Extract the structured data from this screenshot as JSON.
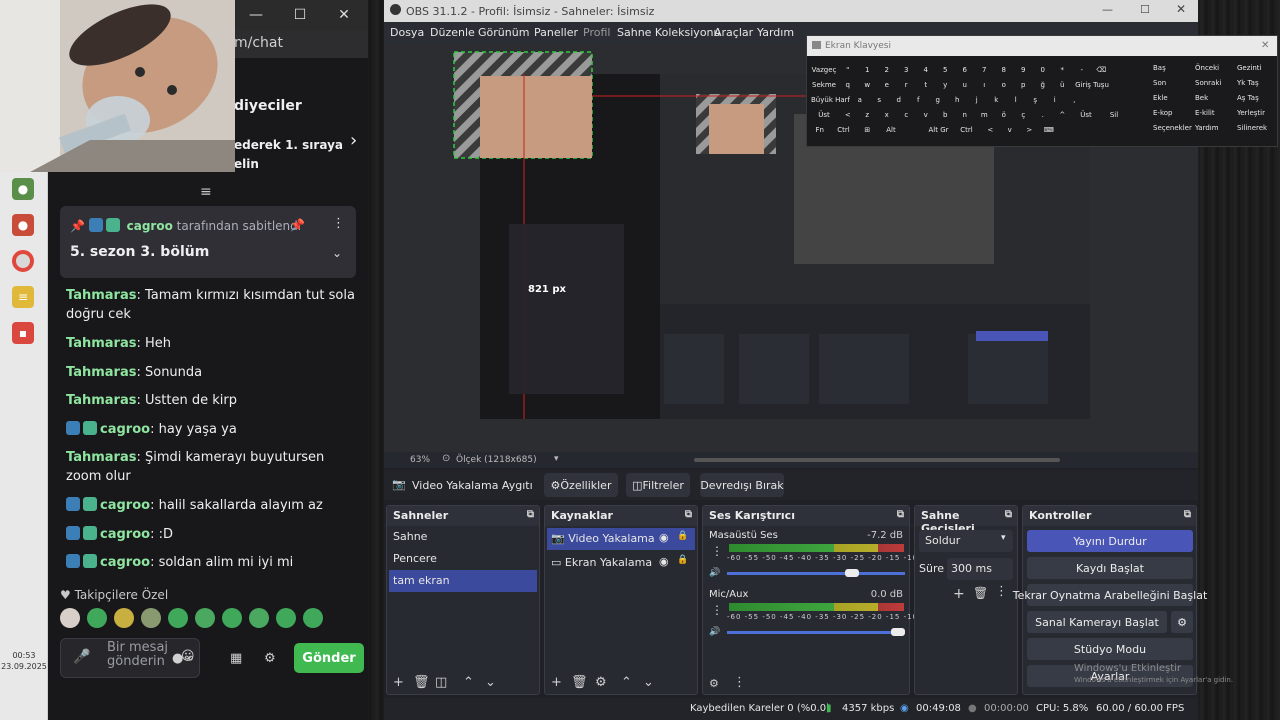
{
  "chat": {
    "url_fragment": "m/chat",
    "header_line1": "diyeciler",
    "header_line2": "ederek 1. sıraya elin",
    "pinned_by_user": "cagroo",
    "pinned_by_suffix": "tarafından sabitlendi",
    "pinned_message": "5. sezon 3. bölüm",
    "messages": [
      {
        "user": "Tahmaras",
        "text": "Tamam kırmızı kısımdan tut sola doğru cek",
        "badges": false
      },
      {
        "user": "Tahmaras",
        "text": "Heh",
        "badges": false
      },
      {
        "user": "Tahmaras",
        "text": "Sonunda",
        "badges": false
      },
      {
        "user": "Tahmaras",
        "text": "Ustten de kirp",
        "badges": false
      },
      {
        "user": "cagroo",
        "text": "hay yaşa ya",
        "badges": true
      },
      {
        "user": "Tahmaras",
        "text": "Şimdi kamerayı buyutursen zoom olur",
        "badges": false
      },
      {
        "user": "cagroo",
        "text": "halil sakallarda alayım az",
        "badges": true
      },
      {
        "user": "cagroo",
        "text": ":D",
        "badges": true
      },
      {
        "user": "cagroo",
        "text": "soldan alim mi iyi mi",
        "badges": true
      }
    ],
    "emote_section": "Takipçilere Özel",
    "input_placeholder": "Bir mesaj gönderin",
    "send_label": "Gönder"
  },
  "taskbar": {
    "time": "00:53",
    "date": "23.09.2025"
  },
  "obs": {
    "title": "OBS 31.1.2 - Profil: İsimsiz - Sahneler: İsimsiz",
    "menu": [
      "Dosya",
      "Düzenle",
      "Görünüm",
      "Paneller",
      "Profil",
      "Sahne Koleksiyonu",
      "Araçlar",
      "Yardım"
    ],
    "preview_size_label": "821 px",
    "zoom": "63%",
    "scale_label": "Ölçek (1218x685)",
    "source_toolbar": {
      "selected_source": "Video Yakalama Aygıtı",
      "properties": "Özellikler",
      "filters": "Filtreler",
      "deactivate": "Devredışı Bırak"
    },
    "scenes": {
      "title": "Sahneler",
      "items": [
        "Sahne",
        "Pencere",
        "tam ekran"
      ]
    },
    "sources": {
      "title": "Kaynaklar",
      "items": [
        "Video Yakalama Aygıtı",
        "Ekran Yakalama"
      ]
    },
    "mixer": {
      "title": "Ses Karıştırıcı",
      "scale": "-60 -55 -50 -45 -40 -35 -30 -25 -20 -15 -10 -5 0",
      "channels": [
        {
          "name": "Masaüstü Ses",
          "db": "-7.2 dB",
          "level": 0.72
        },
        {
          "name": "Mic/Aux",
          "db": "0.0 dB",
          "level": 1.0
        }
      ]
    },
    "transitions": {
      "title": "Sahne Geçişleri",
      "selected": "Soldur",
      "duration_label": "Süre",
      "duration_value": "300 ms"
    },
    "controls": {
      "title": "Kontroller",
      "buttons": [
        "Yayını Durdur",
        "Kaydı Başlat",
        "Tekrar Oynatma Arabelleğini Başlat",
        "Sanal Kamerayı Başlat",
        "Stüdyo Modu",
        "Ayarlar"
      ]
    },
    "status": {
      "dropped": "Kaybedilen Kareler 0 (%0.0)",
      "bitrate": "4357 kbps",
      "stream_time": "00:49:08",
      "rec_time": "00:00:00",
      "cpu": "CPU: 5.8%",
      "fps": "60.00 / 60.00 FPS"
    }
  },
  "osk": {
    "title": "Ekran Klavyesi",
    "rows": [
      [
        "Vazgeç",
        "\"",
        "1",
        "2",
        "3",
        "4",
        "5",
        "6",
        "7",
        "8",
        "9",
        "0",
        "*",
        "-",
        "⌫"
      ],
      [
        "Sekme",
        "q",
        "w",
        "e",
        "r",
        "t",
        "y",
        "u",
        "ı",
        "o",
        "p",
        "ğ",
        "ü",
        "Giriş Tuşu"
      ],
      [
        "Büyük Harf",
        "a",
        "s",
        "d",
        "f",
        "g",
        "h",
        "j",
        "k",
        "l",
        "ş",
        "i",
        ","
      ],
      [
        "Üst",
        "<",
        "z",
        "x",
        "c",
        "v",
        "b",
        "n",
        "m",
        "ö",
        "ç",
        ".",
        "^",
        "Üst",
        "Sil"
      ],
      [
        "Fn",
        "Ctrl",
        "⊞",
        "Alt",
        "",
        "Alt Gr",
        "Ctrl",
        "<",
        "v",
        ">",
        "⌨"
      ]
    ],
    "nav": [
      [
        "Baş",
        "Önceki",
        "Gezinti"
      ],
      [
        "Son",
        "Sonraki",
        "Yk Taş"
      ],
      [
        "Ekle",
        "Bek",
        "Aş Taş"
      ],
      [
        "E-kop",
        "E-kilit",
        "Yerleştir"
      ],
      [
        "Seçenekler",
        "Yardım",
        "Silinerek"
      ]
    ]
  },
  "watermark": {
    "line1": "Windows'u Etkinleştir",
    "line2": "Windows'u etkinleştirmek için Ayarlar'a gidin."
  }
}
